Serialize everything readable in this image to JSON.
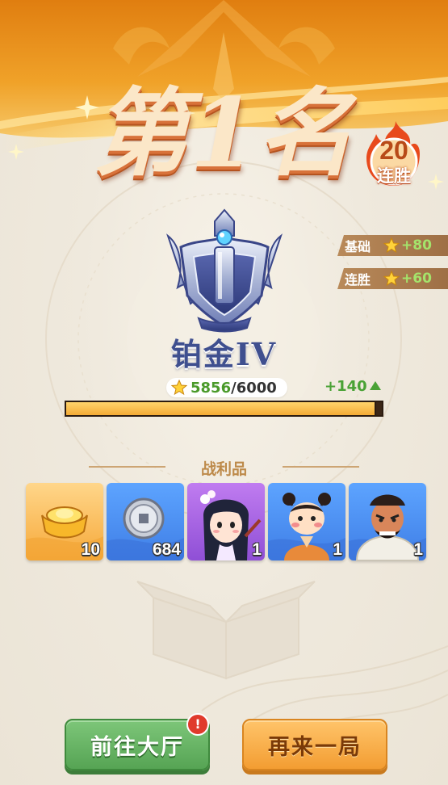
{
  "rank": {
    "title": "第1名"
  },
  "streak": {
    "count": "20",
    "label": "连胜"
  },
  "bonuses": [
    {
      "label": "基础",
      "value": "+80"
    },
    {
      "label": "连胜",
      "value": "+60"
    }
  ],
  "tier": {
    "name": "铂金IV"
  },
  "score": {
    "current": "5856",
    "separator": "/",
    "max": "6000",
    "gain": "+140",
    "progress_fraction": 0.976
  },
  "loot": {
    "title": "战利品",
    "items": [
      {
        "name": "gold-ingot",
        "count": "10"
      },
      {
        "name": "silver-coin",
        "count": "684"
      },
      {
        "name": "hero-girl-portrait",
        "count": "1"
      },
      {
        "name": "hero-boy-portrait",
        "count": "1"
      },
      {
        "name": "hero-warrior-portrait",
        "count": "1"
      }
    ]
  },
  "buttons": {
    "lobby": "前往大厅",
    "again": "再来一局",
    "notification": "!"
  },
  "colors": {
    "banner": "#e8861a",
    "accent_green": "#4aa236",
    "tier_blue": "#3f4f8f",
    "progress": "#f4ab36"
  }
}
